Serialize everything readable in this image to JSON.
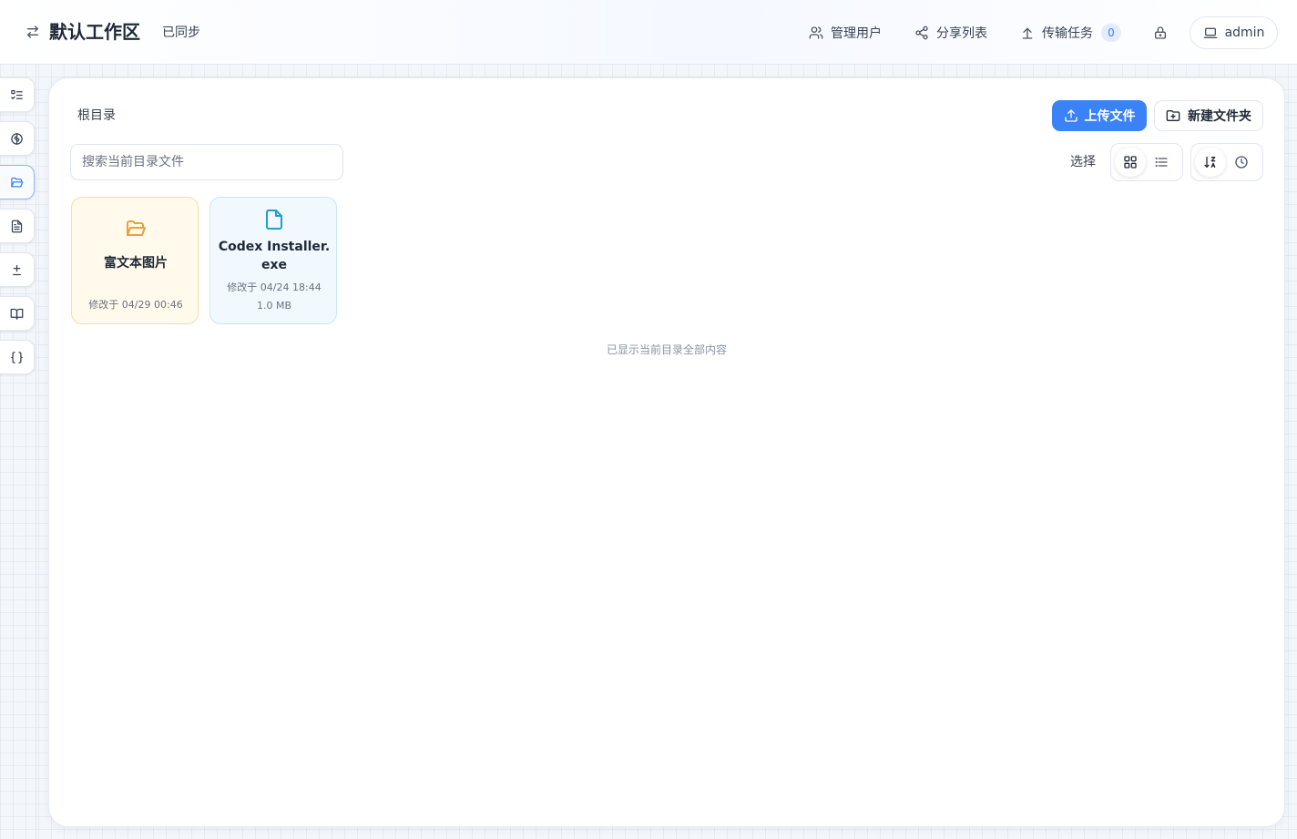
{
  "header": {
    "workspace_title": "默认工作区",
    "sync_status": "已同步",
    "nav": [
      {
        "label": "管理用户",
        "icon": "users-icon"
      },
      {
        "label": "分享列表",
        "icon": "share-icon"
      },
      {
        "label": "传输任务",
        "icon": "upload-icon",
        "badge": "0"
      }
    ],
    "lock_icon": "lock-icon",
    "user": {
      "label": "admin",
      "icon": "laptop-icon"
    }
  },
  "sidebar": {
    "items": [
      {
        "name": "tasks",
        "icon": "list-checks-icon",
        "active": false
      },
      {
        "name": "brain",
        "icon": "brain-icon",
        "active": false
      },
      {
        "name": "files",
        "icon": "folder-open-icon",
        "active": true
      },
      {
        "name": "document",
        "icon": "file-text-icon",
        "active": false
      },
      {
        "name": "diff",
        "icon": "plus-minus-icon",
        "active": false
      },
      {
        "name": "book",
        "icon": "book-open-icon",
        "active": false
      },
      {
        "name": "json",
        "icon": "braces-icon",
        "active": false
      }
    ]
  },
  "main": {
    "breadcrumb": "根目录",
    "upload_label": "上传文件",
    "new_folder_label": "新建文件夹",
    "search_placeholder": "搜索当前目录文件",
    "select_label": "选择",
    "view_mode": "grid",
    "items": [
      {
        "type": "folder",
        "name": "富文本图片",
        "modified": "修改于 04/29 00:46"
      },
      {
        "type": "file",
        "name": "Codex Installer.exe",
        "modified": "修改于 04/24 18:44",
        "size": "1.0 MB"
      }
    ],
    "end_message": "已显示当前目录全部内容"
  },
  "colors": {
    "accent": "#3b82f6",
    "folder_bg": "#fffaeb",
    "folder_border": "#f8df9a",
    "file_bg": "#f1f9fe",
    "file_border": "#c7e7f8"
  }
}
